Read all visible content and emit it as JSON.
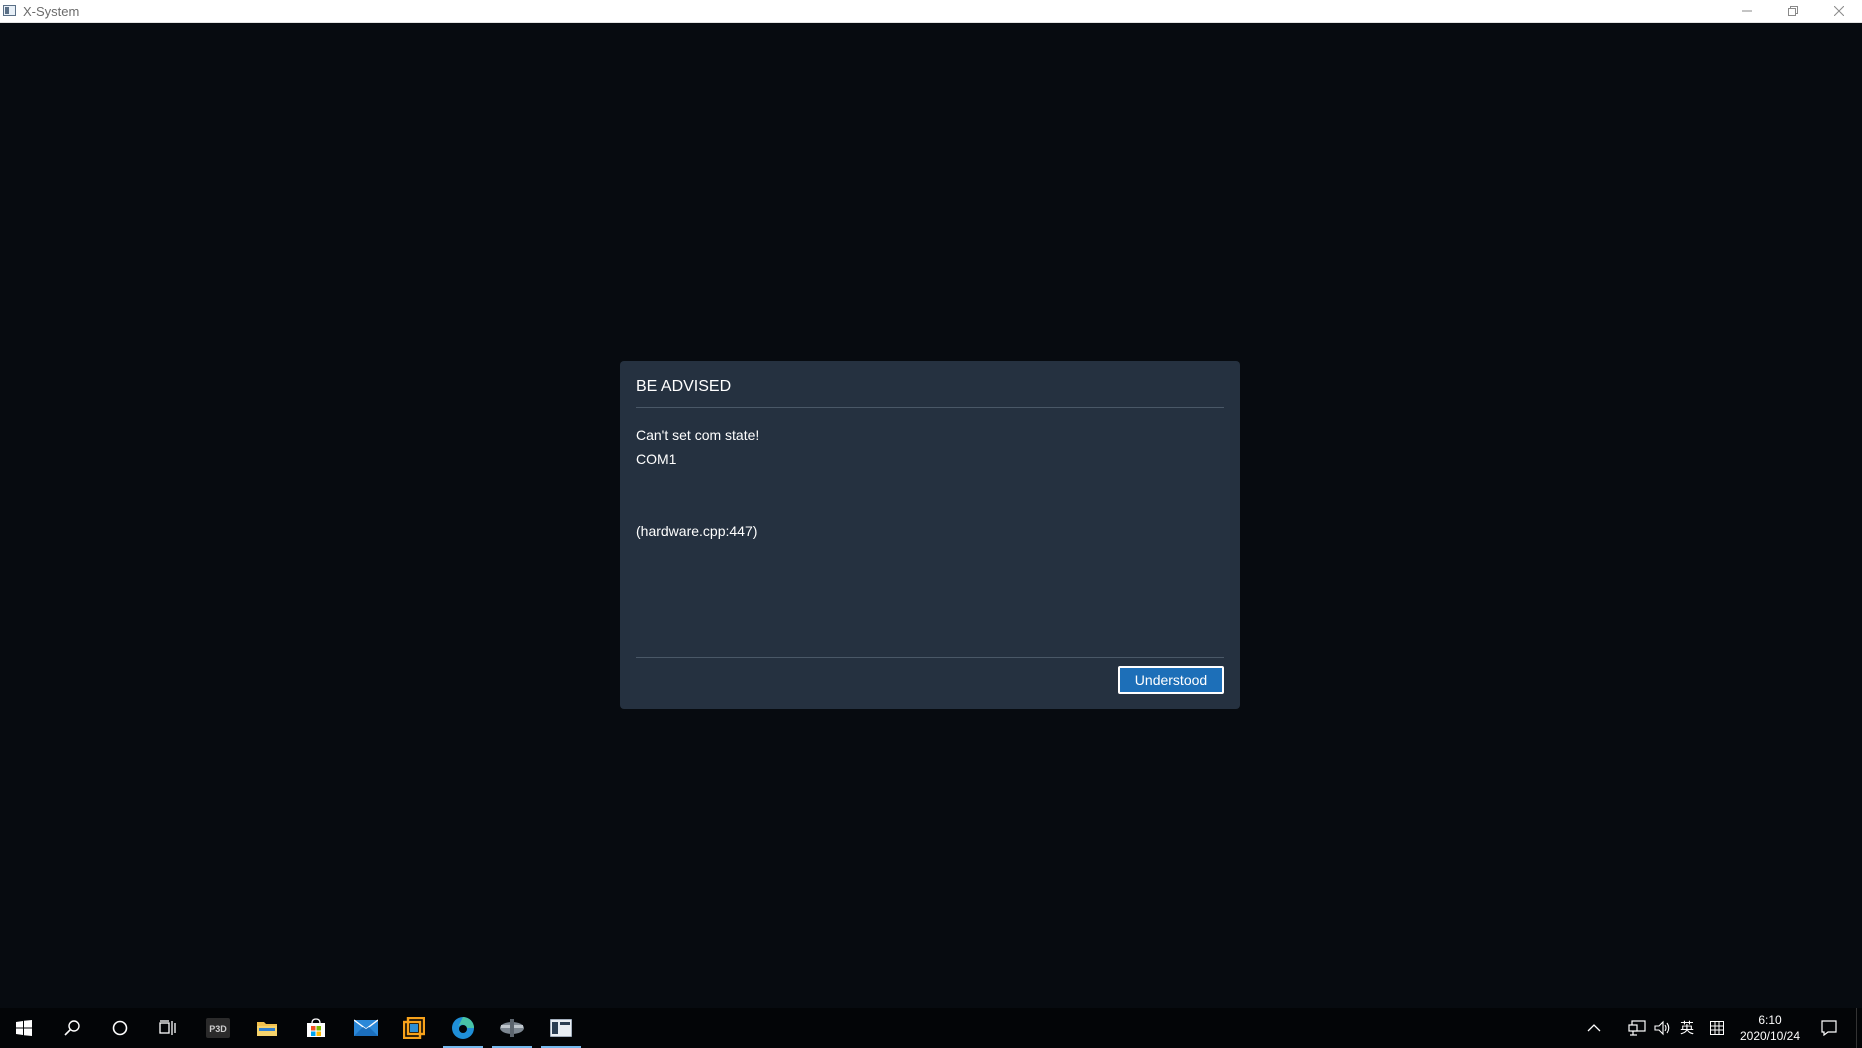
{
  "window": {
    "title": "X-System",
    "controls": [
      "minimize",
      "restore",
      "close"
    ]
  },
  "dialog": {
    "title": "BE ADVISED",
    "message_lines": [
      "Can't set com state!",
      "COM1"
    ],
    "source_ref": "(hardware.cpp:447)",
    "button_label": "Understood",
    "colors": {
      "background": "#253140",
      "button": "#1d6fb8"
    }
  },
  "taskbar": {
    "items": [
      {
        "name": "start-icon"
      },
      {
        "name": "search-icon"
      },
      {
        "name": "cortana-icon"
      },
      {
        "name": "task-view-icon"
      },
      {
        "name": "p3d-app-icon",
        "label": "P3D"
      },
      {
        "name": "file-explorer-icon"
      },
      {
        "name": "store-icon"
      },
      {
        "name": "mail-icon"
      },
      {
        "name": "orange-app-icon"
      },
      {
        "name": "edge-icon",
        "active": true
      },
      {
        "name": "aircraft-app-icon",
        "active": true
      },
      {
        "name": "x-system-app-icon",
        "active": true
      }
    ],
    "tray": {
      "ime_label": "英",
      "time": "6:10",
      "date": "2020/10/24"
    }
  }
}
